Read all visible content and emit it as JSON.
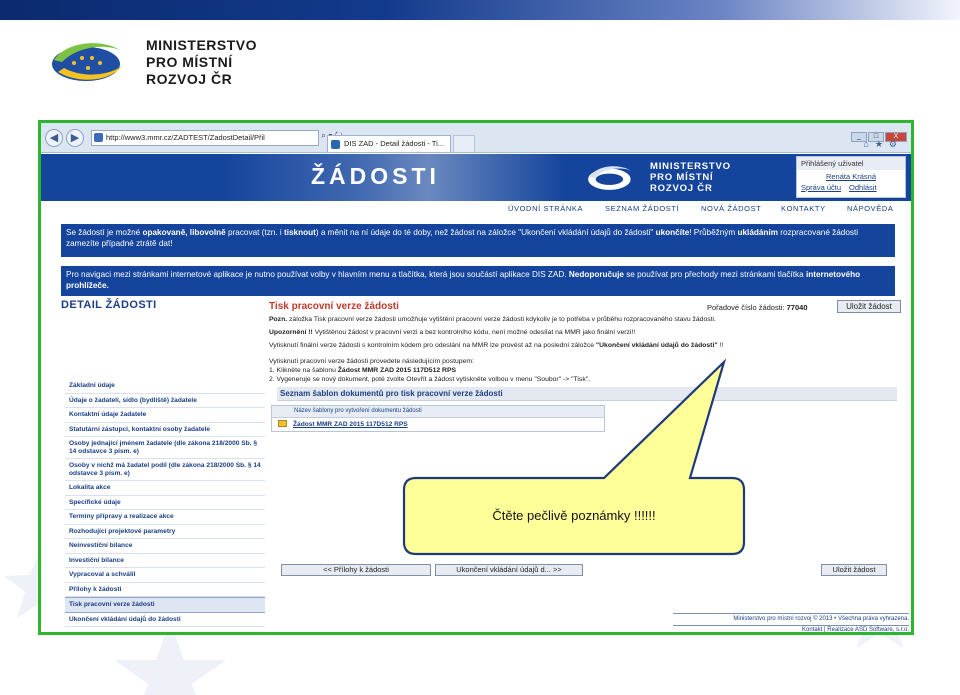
{
  "slide": {
    "logo_lines": [
      "MINISTERSTVO",
      "PRO MÍSTNÍ",
      "ROZVOJ ČR"
    ]
  },
  "browser": {
    "address": "http://www3.mmr.cz/ZADTEST/ZadostDetail/Přil",
    "tab_title": "DIS ZAD - Detail žádosti - Ti...",
    "window_buttons": [
      "_",
      "□",
      "X"
    ]
  },
  "header": {
    "title": "ŽÁDOSTI",
    "logo_lines": [
      "MINISTERSTVO",
      "PRO MÍSTNÍ",
      "ROZVOJ ČR"
    ],
    "user_label": "Přihlášený uživatel",
    "user_name": "Renáta Krásná",
    "account_link": "Správa účtu",
    "logout_link": "Odhlásit"
  },
  "menu": [
    "ÚVODNÍ STRÁNKA",
    "SEZNAM ŽÁDOSTÍ",
    "NOVÁ ŽÁDOST",
    "KONTAKTY",
    "NÁPOVĚDA"
  ],
  "notice1": {
    "a": "Se žádostí je možné ",
    "b": "opakovaně, libovolně",
    "c": " pracovat (tzn. i ",
    "d": "tisknout",
    "e": ") a měnit na ní údaje do té doby, než žádost na záložce \"Ukončení vkládání údajů do žádosti\" ",
    "f": "ukončíte",
    "g": "! Průběžným ",
    "h": "ukládáním",
    "i": " rozpracované žádosti zamezíte případné ztrátě dat!"
  },
  "notice2": {
    "a": "Pro navigaci mezi stránkami internetové aplikace je nutno používat volby v hlavním menu a tlačítka, která jsou součástí aplikace DIS ZAD. ",
    "b": "Nedoporučuje",
    "c": " se používat pro přechody mezi stránkami tlačítka ",
    "d": "internetového prohlížeče."
  },
  "page_heading": "DETAIL ŽÁDOSTI",
  "sidebar": [
    "Základní údaje",
    "Údaje o žadateli, sídlo (bydliště) žadatele",
    "Kontaktní údaje žadatele",
    "Statutární zástupci, kontaktní osoby žadatele",
    "Osoby jednající jménem žadatele (dle zákona 218/2000 Sb. § 14 odstavce 3 písm. e)",
    "Osoby v nichž má žadatel podíl (dle zákona 218/2000 Sb. § 14 odstavce 3 písm. e)",
    "Lokalita akce",
    "Specifické údaje",
    "Termíny přípravy a realizace akce",
    "Rozhodující projektové parametry",
    "Neinvestiční bilance",
    "Investiční bilance",
    "Vypracoval a schválil",
    "Přílohy k žádosti",
    "Tisk pracovní verze žádosti",
    "Ukončení vkládání údajů do žádosti"
  ],
  "content": {
    "heading": "Tisk pracovní verze žádosti",
    "order_label": "Pořadové číslo žádosti: ",
    "order_number": "77040",
    "save_label": "Uložit žádost",
    "line1_a": "Pozn. ",
    "line1_b": "záložka Tisk pracovní verze žádosti umožňuje vytištění pracovní verze žádosti kdykoliv je to potřeba v průběhu rozpracovaného stavu žádosti.",
    "line2_a": "Upozornění !! ",
    "line2_b": "Vytištěnou žádost v pracovní verzi a bez kontrolního kódu, není možné odesílat na MMR jako finální verzi!!",
    "line3_a": "Vytisknutí finální verze žádosti s kontrolním kódem pro odeslání na MMR lze provést až na poslední záložce ",
    "line3_b": "\"Ukončení vkládání údajů do žádosti\"",
    "line3_c": " !!",
    "line4": "Vytisknutí pracovní verze žádosti provedete následujícím postupem:",
    "line5_a": "1. Klikněte na šablonu ",
    "line5_b": "Žádost MMR ZAD 2015 117D512 RPS",
    "line6": "2. Vygeneruje se nový dokument, poté zvolte Otevřít a žádost vytiskněte volbou v menu \"Soubor\" -> \"Tisk\".",
    "templates_heading": "Seznam šablon dokumentů pro tisk pracovní verze žádosti",
    "table_header": "Název šablony pro vytvoření dokumentu žádosti",
    "template_name": "Žádost MMR ZAD 2015 117D512 RPS",
    "btn_prev": "<<  Přílohy k žádosti",
    "btn_next": "Ukončení vkládání údajů d...  >>",
    "btn_save": "Uložit žádost"
  },
  "footer": {
    "line1": "Ministerstvo pro místní rozvoj © 2013 • Všechna práva vyhrazena.",
    "line2": "Kontakt | Realizace ASD Software, s.r.o."
  },
  "callout": {
    "text": "Čtěte pečlivě poznámky !!!!!!"
  },
  "colors": {
    "frame_border": "#2db52d",
    "header_blue": "#14449c",
    "heading_red": "#c0392b",
    "callout_fill": "#ffff99"
  }
}
